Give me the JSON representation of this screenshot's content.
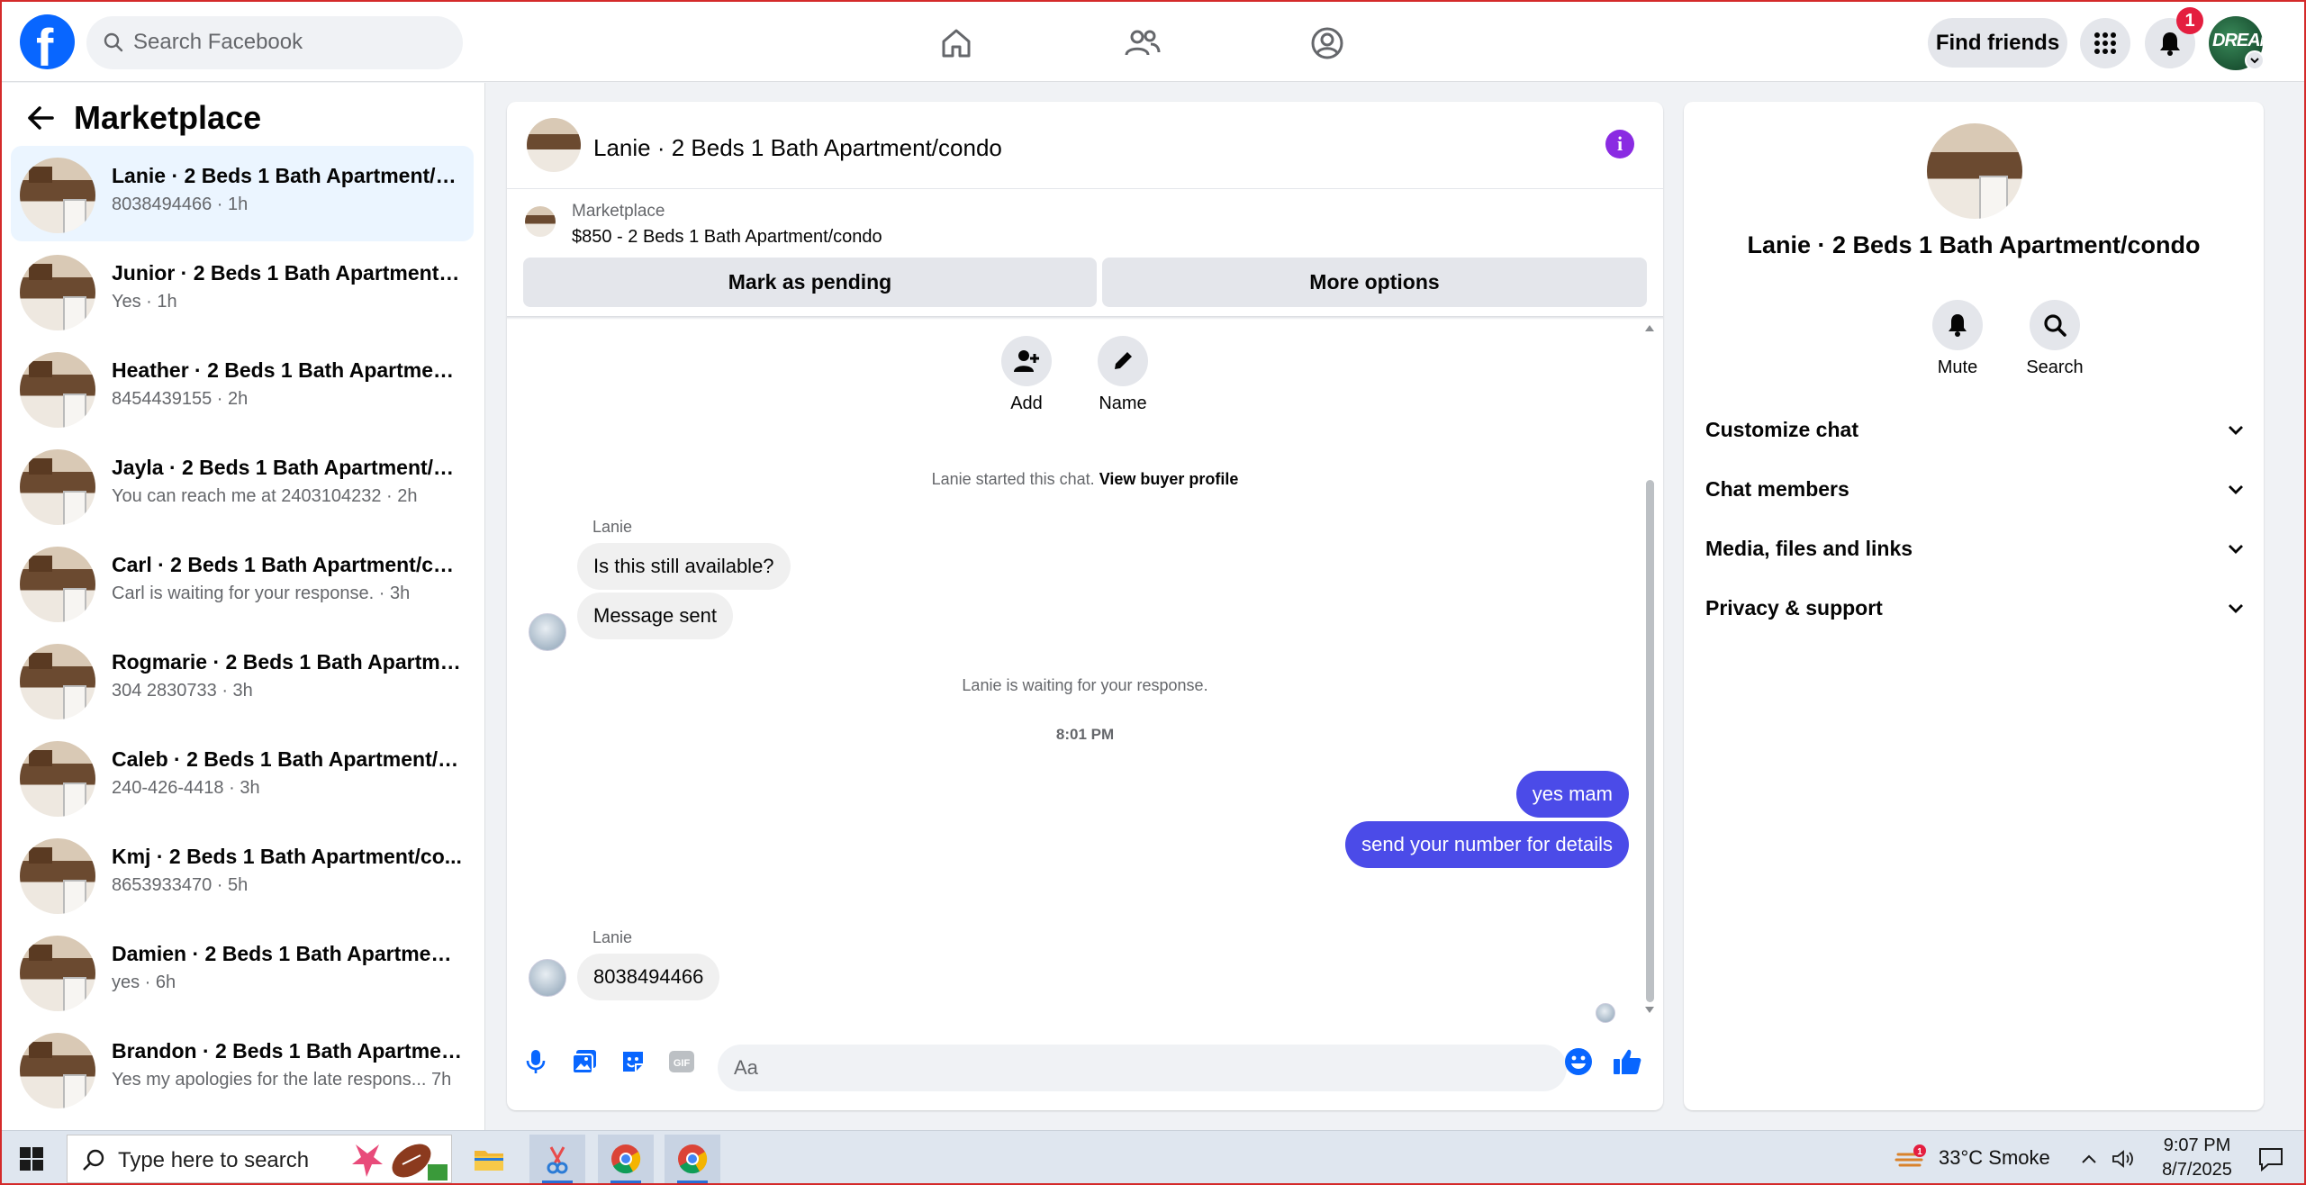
{
  "topbar": {
    "search_placeholder": "Search Facebook",
    "find_friends_label": "Find friends",
    "notification_count": "1",
    "avatar_text": "DREAM"
  },
  "sidebar": {
    "title": "Marketplace",
    "conversations": [
      {
        "title": "Lanie · 2 Beds 1 Bath Apartment/c...",
        "subtitle": "8038494466 · 1h",
        "active": true
      },
      {
        "title": "Junior · 2 Beds 1 Bath Apartment/c...",
        "subtitle": "Yes · 1h"
      },
      {
        "title": "Heather · 2 Beds 1 Bath Apartment...",
        "subtitle": "8454439155 · 2h"
      },
      {
        "title": "Jayla · 2 Beds 1 Bath Apartment/co...",
        "subtitle": "You can reach me at 2403104232 · 2h"
      },
      {
        "title": "Carl · 2 Beds 1 Bath Apartment/co...",
        "subtitle": "Carl is waiting for your response. · 3h"
      },
      {
        "title": "Rogmarie · 2 Beds 1 Bath Apartme...",
        "subtitle": "304 2830733 · 3h"
      },
      {
        "title": "Caleb · 2 Beds 1 Bath Apartment/c...",
        "subtitle": "240-426-4418 · 3h"
      },
      {
        "title": "Kmj · 2 Beds 1 Bath Apartment/co...",
        "subtitle": "8653933470 · 5h"
      },
      {
        "title": "Damien · 2 Beds 1 Bath Apartment...",
        "subtitle": "yes · 6h"
      },
      {
        "title": "Brandon · 2 Beds 1 Bath Apartmen...",
        "subtitle": "Yes my apologies for the late respons...   7h"
      }
    ]
  },
  "chat": {
    "title": "Lanie · 2 Beds 1 Bath Apartment/condo",
    "marketplace_label": "Marketplace",
    "listing": "$850 - 2 Beds 1 Bath Apartment/condo",
    "mark_pending_label": "Mark as pending",
    "more_options_label": "More options",
    "actions": {
      "add": "Add",
      "name": "Name"
    },
    "started_text": "Lanie started this chat.",
    "view_profile_label": "View buyer profile",
    "sender1": "Lanie",
    "msg1": "Is this still available?",
    "msg2": "Message sent",
    "waiting_text": "Lanie is waiting for your response.",
    "timestamp": "8:01 PM",
    "out1": "yes mam",
    "out2": "send your number for details",
    "sender2": "Lanie",
    "msg3": "8038494466",
    "composer_placeholder": "Aa"
  },
  "details": {
    "name": "Lanie · 2 Beds 1 Bath Apartment/condo",
    "mute_label": "Mute",
    "search_label": "Search",
    "sections": [
      "Customize chat",
      "Chat members",
      "Media, files and links",
      "Privacy & support"
    ]
  },
  "taskbar": {
    "search_placeholder": "Type here to search",
    "weather": "33°C  Smoke",
    "time": "9:07 PM",
    "date": "8/7/2025",
    "weather_badge": "1"
  },
  "colors": {
    "accent": "#0866ff",
    "outgoing_bubble": "#4b4be8",
    "info_icon": "#8a2be2"
  }
}
